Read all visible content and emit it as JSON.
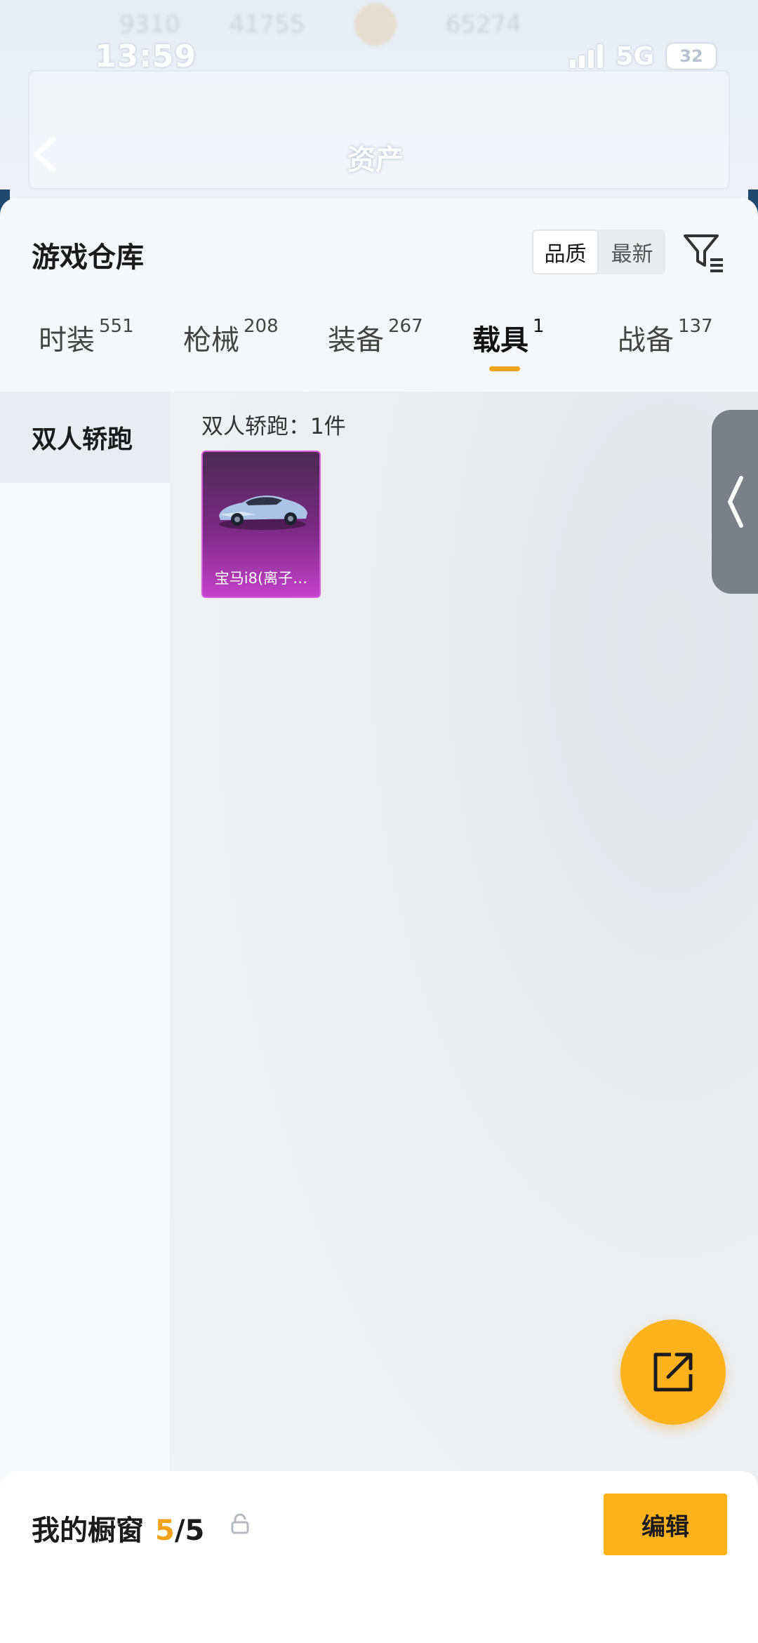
{
  "status_bar": {
    "time": "13:59",
    "network": "5G",
    "battery": "32"
  },
  "background_ghost": {
    "stat_1": "9310",
    "stat_2": "41755",
    "stat_3": "65274",
    "title": "资产"
  },
  "warehouse": {
    "title": "游戏仓库",
    "sort_options": [
      "品质",
      "最新"
    ],
    "active_sort": "品质"
  },
  "tabs": [
    {
      "label": "时装",
      "count": "551"
    },
    {
      "label": "枪械",
      "count": "208"
    },
    {
      "label": "装备",
      "count": "267"
    },
    {
      "label": "载具",
      "count": "1",
      "active": true
    },
    {
      "label": "战备",
      "count": "137"
    }
  ],
  "categories": [
    {
      "label": "双人轿跑",
      "active": true
    }
  ],
  "group": {
    "label": "双人轿跑：1件",
    "items": [
      {
        "name": "宝马i8(离子…",
        "rarity_color": "#c341c9"
      }
    ]
  },
  "showcase": {
    "label": "我的橱窗",
    "used": "5",
    "separator": "/",
    "total": "5"
  },
  "edit_button": "编辑",
  "colors": {
    "accent": "#fbb21c",
    "tab_underline": "#f0a31a",
    "rarity_purple": "#c341c9"
  }
}
